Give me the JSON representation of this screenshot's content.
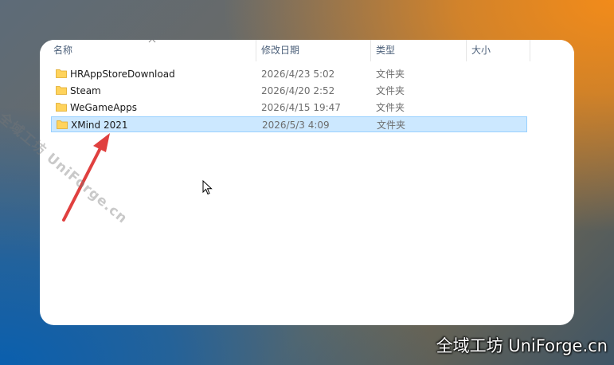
{
  "columns": {
    "name": "名称",
    "modified": "修改日期",
    "type": "类型",
    "size": "大小"
  },
  "sort_icon": "chevron-up-icon",
  "files": [
    {
      "name": "HRAppStoreDownload",
      "modified": "2026/4/23 5:02",
      "type": "文件夹",
      "size": "",
      "icon": "folder-icon",
      "selected": false
    },
    {
      "name": "Steam",
      "modified": "2026/4/20 2:52",
      "type": "文件夹",
      "size": "",
      "icon": "folder-icon",
      "selected": false
    },
    {
      "name": "WeGameApps",
      "modified": "2026/4/15 19:47",
      "type": "文件夹",
      "size": "",
      "icon": "folder-icon",
      "selected": false
    },
    {
      "name": "XMind 2021",
      "modified": "2026/5/3 4:09",
      "type": "文件夹",
      "size": "",
      "icon": "folder-icon",
      "selected": true
    }
  ],
  "watermark": {
    "diagonal": "全域工坊 UniForge.cn",
    "corner": "全域工坊 UniForge.cn"
  },
  "colors": {
    "selection": "#cce8ff",
    "selection_border": "#99d1ff",
    "folder": "#ffd35c",
    "arrow": "#e0403f",
    "header_text": "#4c607a"
  }
}
